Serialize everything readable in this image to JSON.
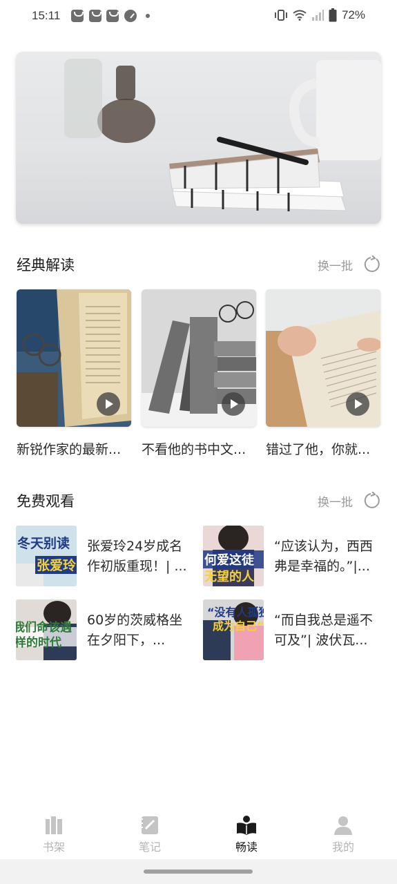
{
  "status_bar": {
    "time": "15:11",
    "battery": "72%",
    "icons": [
      "notification-icon",
      "notification-icon",
      "notification-icon",
      "gauge-icon",
      "dot-icon",
      "vibrate-icon",
      "wifi-icon",
      "signal-icon",
      "battery-icon"
    ]
  },
  "sections": {
    "classic": {
      "title": "经典解读",
      "refresh_label": "换一批",
      "cards": [
        {
          "title": "新锐作家的最新..."
        },
        {
          "title": "不看他的书中文..."
        },
        {
          "title": "错过了他，你就..."
        }
      ]
    },
    "free": {
      "title": "免费观看",
      "refresh_label": "换一批",
      "items": [
        {
          "title": "张爱玲24岁成名作初版重现！| ...",
          "thumb_text": [
            "冬天别读",
            "张爱玲"
          ]
        },
        {
          "title": "“应该认为，西西弗是幸福的。”|...",
          "thumb_text": [
            "何爱这徒",
            "无望的人"
          ]
        },
        {
          "title": "60岁的茨威格坐在夕阳下，...",
          "thumb_text": [
            "我们命该遇",
            "样的时代"
          ]
        },
        {
          "title": "“而自我总是遥不可及”| 波伏瓦...",
          "thumb_text": [
            "“没有人孤独",
            "成为自己”"
          ]
        }
      ]
    }
  },
  "bottom_nav": {
    "items": [
      {
        "label": "书架",
        "icon": "bookshelf-icon",
        "active": false
      },
      {
        "label": "笔记",
        "icon": "notes-icon",
        "active": false
      },
      {
        "label": "畅读",
        "icon": "reading-icon",
        "active": true
      },
      {
        "label": "我的",
        "icon": "profile-icon",
        "active": false
      }
    ]
  },
  "colors": {
    "accent_active": "#1b1b1b",
    "inactive": "#b5b5b5",
    "muted_text": "#9a9a9a"
  }
}
